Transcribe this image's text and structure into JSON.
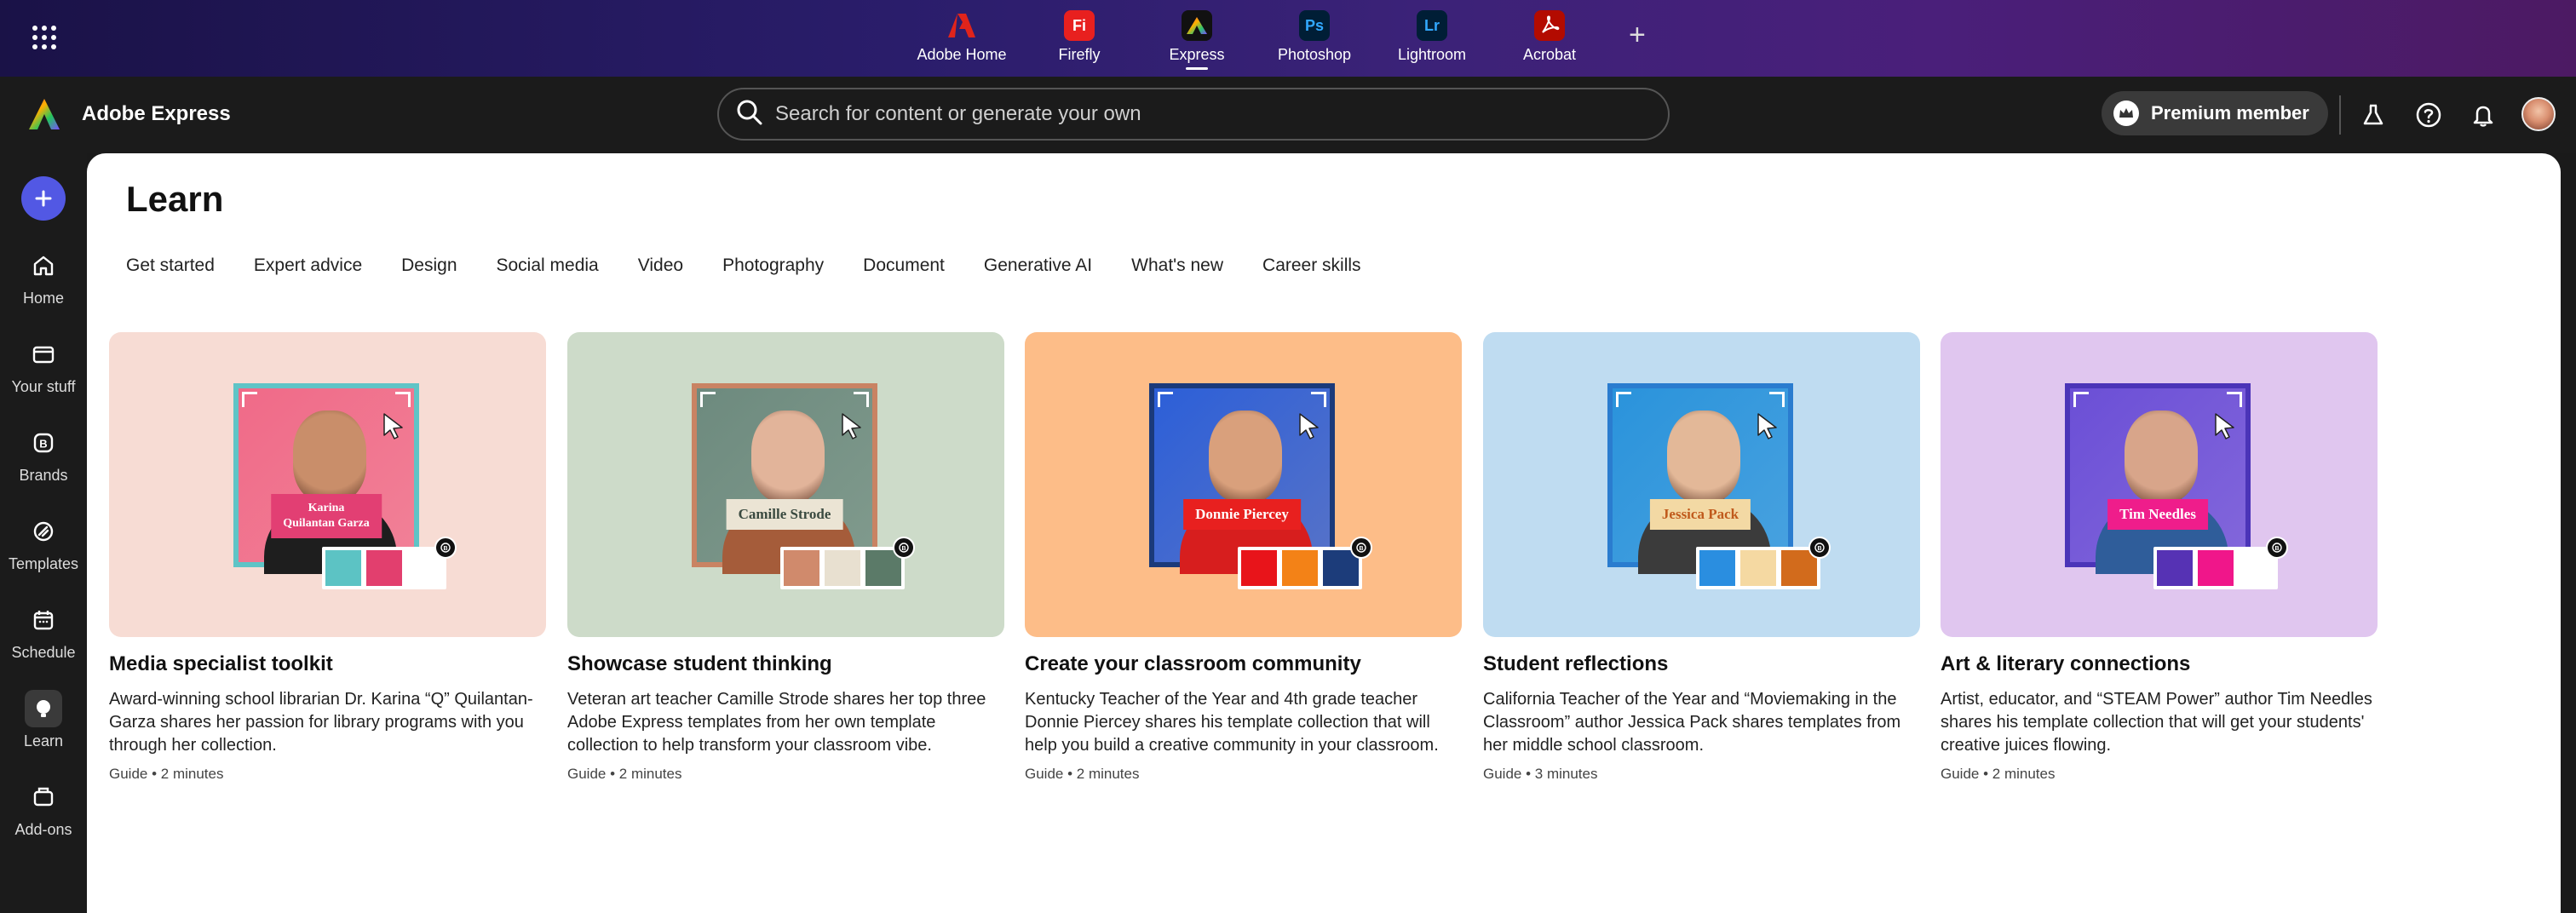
{
  "top_apps": [
    {
      "label": "Adobe Home",
      "icon": "adobe-home-icon",
      "bg": "transparent",
      "fg": "#e0241b",
      "glyph": "A"
    },
    {
      "label": "Firefly",
      "icon": "firefly-icon",
      "bg": "#e8201f",
      "fg": "#ffffff",
      "glyph": "Fi"
    },
    {
      "label": "Express",
      "icon": "express-icon",
      "bg": "#111111",
      "fg": "#ffffff",
      "glyph": "A"
    },
    {
      "label": "Photoshop",
      "icon": "photoshop-icon",
      "bg": "#001e36",
      "fg": "#31a8ff",
      "glyph": "Ps"
    },
    {
      "label": "Lightroom",
      "icon": "lightroom-icon",
      "bg": "#001e36",
      "fg": "#31a8ff",
      "glyph": "Lr"
    },
    {
      "label": "Acrobat",
      "icon": "acrobat-icon",
      "bg": "#b30b00",
      "fg": "#ffffff",
      "glyph": "✦"
    }
  ],
  "header": {
    "brand": "Adobe Express",
    "search_placeholder": "Search for content or generate your own",
    "premium_label": "Premium member"
  },
  "rail": [
    {
      "label": "Home",
      "icon": "home-icon"
    },
    {
      "label": "Your stuff",
      "icon": "folder-icon"
    },
    {
      "label": "Brands",
      "icon": "brands-icon"
    },
    {
      "label": "Templates",
      "icon": "templates-icon"
    },
    {
      "label": "Schedule",
      "icon": "calendar-icon"
    },
    {
      "label": "Learn",
      "icon": "learn-icon"
    },
    {
      "label": "Add-ons",
      "icon": "addons-icon"
    }
  ],
  "main": {
    "title": "Learn",
    "tabs": [
      "Get started",
      "Expert advice",
      "Design",
      "Social media",
      "Video",
      "Photography",
      "Document",
      "Generative AI",
      "What's new",
      "Career skills"
    ],
    "cards": [
      {
        "title": "Media specialist toolkit",
        "desc": "Award-winning school librarian Dr. Karina “Q” Quilantan-Garza shares her passion for library programs with you through her collection.",
        "meta": "Guide • 2 minutes",
        "bg": "#f7dcd4",
        "photo_bg": "#f06a88",
        "frame_border": "#5fc4c6",
        "name": "Karina\nQuilantan Garza",
        "label_bg": "#e23f73",
        "label_fg": "#ffffff",
        "skin": "#c98e6a",
        "shirt": "#1e1e1e",
        "swatches": [
          "#5cc3c4",
          "#e23f6e",
          "#ffffff"
        ]
      },
      {
        "title": "Showcase student thinking",
        "desc": "Veteran art teacher Camille Strode shares her top three Adobe Express templates from her own template collection to help transform your classroom vibe.",
        "meta": "Guide • 2 minutes",
        "bg": "#cddbc9",
        "photo_bg": "#6d8a7e",
        "frame_border": "#c98363",
        "name": "Camille Strode",
        "label_bg": "#ebe4d4",
        "label_fg": "#3a4a40",
        "skin": "#e2b49a",
        "shirt": "#a55c3a",
        "swatches": [
          "#d08a6c",
          "#e8e0d0",
          "#5b7a68"
        ]
      },
      {
        "title": "Create your classroom community",
        "desc": "Kentucky Teacher of the Year and 4th grade teacher Donnie Piercey shares his template collection that will help you build a creative community in your classroom.",
        "meta": "Guide • 2 minutes",
        "bg": "#fdbd88",
        "photo_bg": "#2c5fd8",
        "frame_border": "#1b3a7a",
        "name": "Donnie Piercey",
        "label_bg": "#e8201f",
        "label_fg": "#ffffff",
        "skin": "#d9a07c",
        "shirt": "#d71e1e",
        "swatches": [
          "#e8141a",
          "#f38217",
          "#1c3c7a"
        ]
      },
      {
        "title": "Student reflections",
        "desc": "California Teacher of the Year and “Moviemaking in the Classroom” author Jessica Pack shares templates from her middle school classroom.",
        "meta": "Guide • 3 minutes",
        "bg": "#bfdcf1",
        "photo_bg": "#2a93db",
        "frame_border": "#2a7ccf",
        "name": "Jessica Pack",
        "label_bg": "#f3d9a4",
        "label_fg": "#c05a1c",
        "skin": "#e3b898",
        "shirt": "#3b3b3b",
        "swatches": [
          "#2a8ee0",
          "#f5d9a2",
          "#d26b1c"
        ]
      },
      {
        "title": "Art & literary connections",
        "desc": "Artist, educator, and “STEAM Power” author Tim Needles shares his template collection that will get your students' creative juices flowing.",
        "meta": "Guide • 2 minutes",
        "bg": "#e0c6ef",
        "photo_bg": "#6b4fd6",
        "frame_border": "#4b34b8",
        "name": "Tim Needles",
        "label_bg": "#ef1d8b",
        "label_fg": "#ffffff",
        "skin": "#d8a58a",
        "shirt": "#2f5d9a",
        "swatches": [
          "#5632b4",
          "#f0168a",
          "#ffffff"
        ]
      }
    ]
  }
}
